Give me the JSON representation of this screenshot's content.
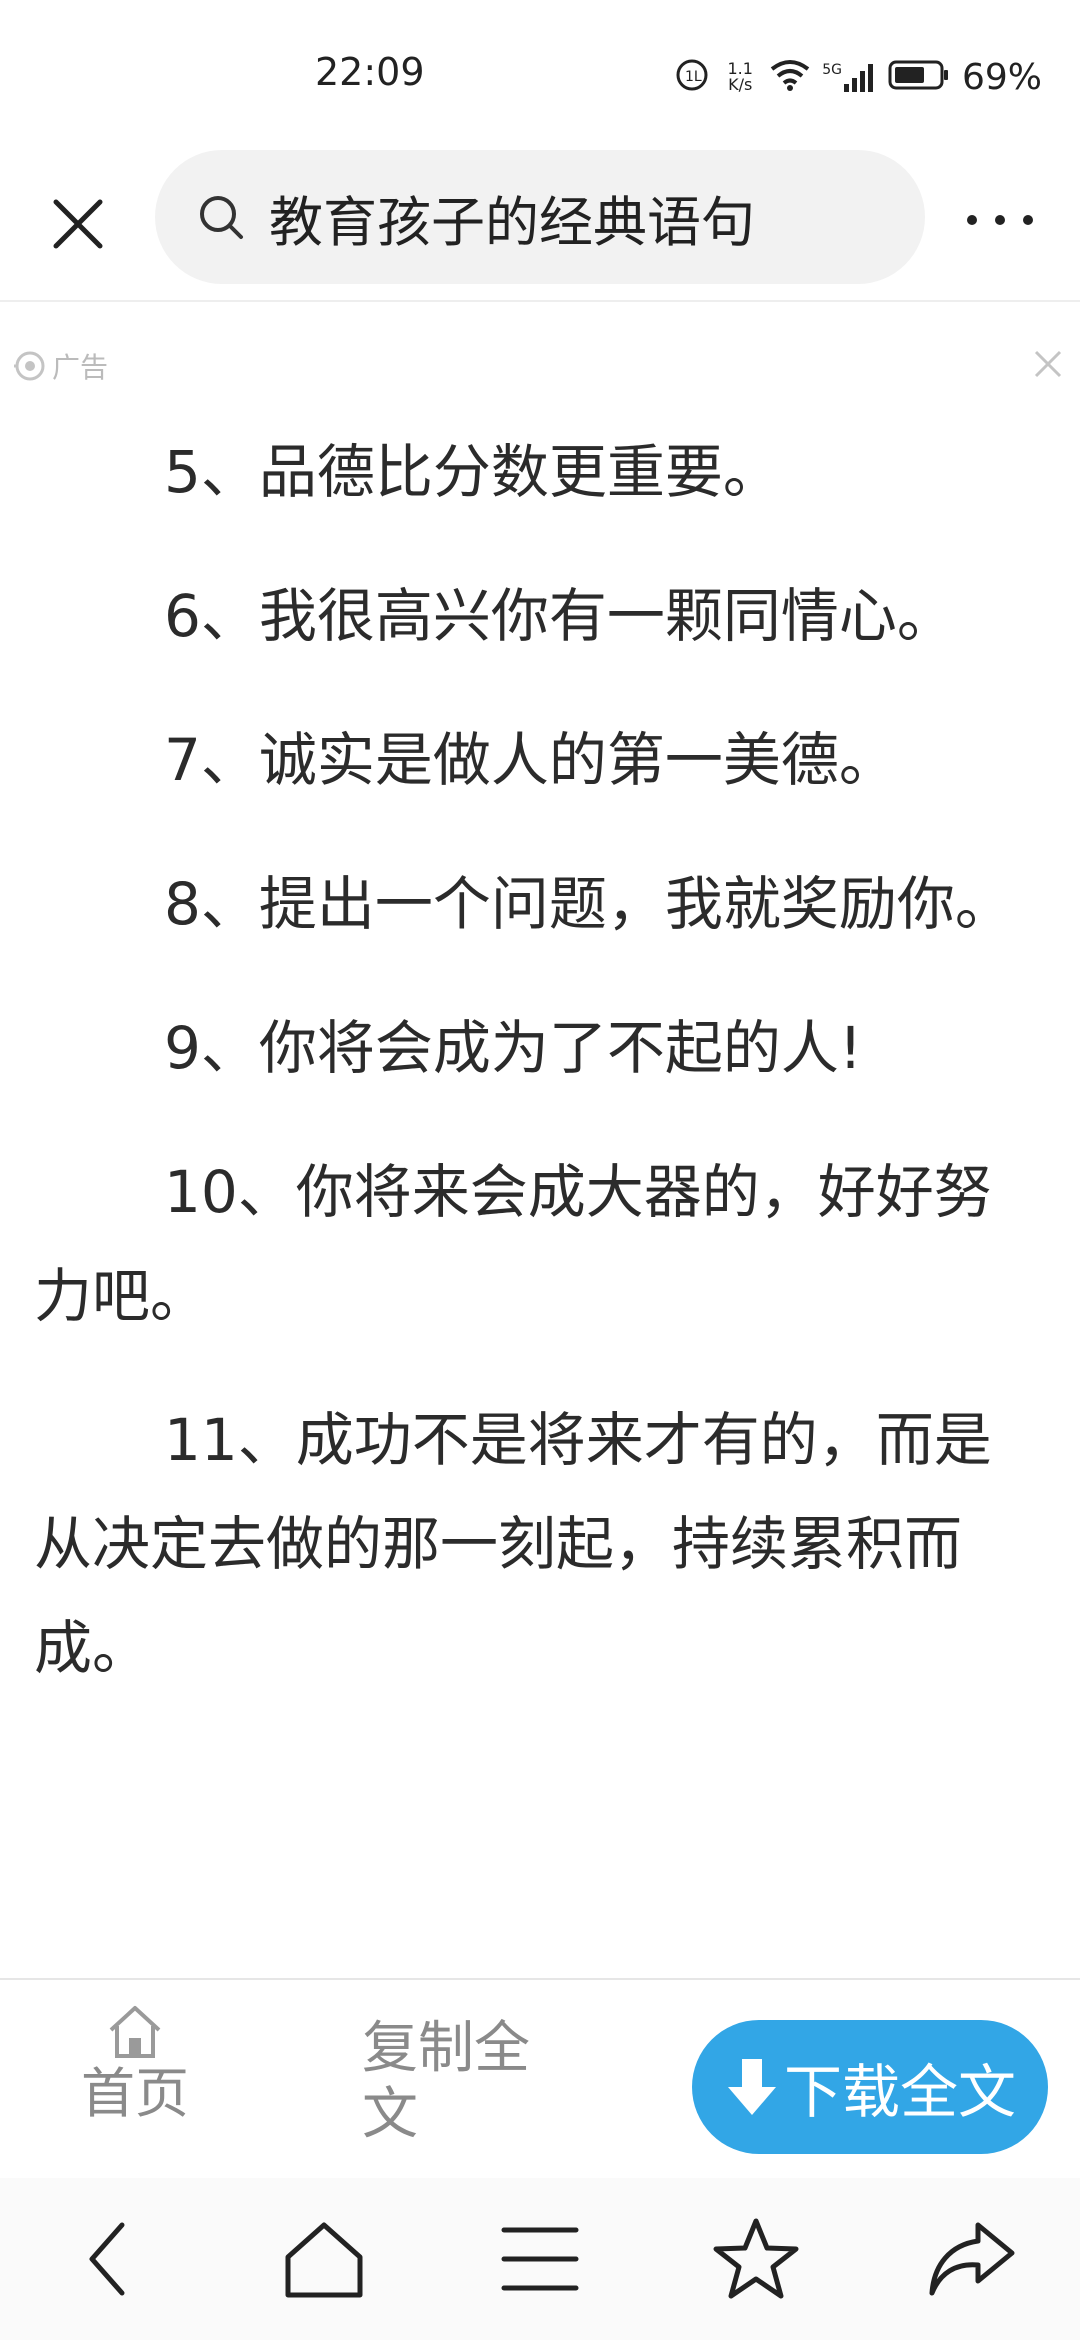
{
  "status_bar": {
    "time": "22:09",
    "net_speed_value": "1.1",
    "net_speed_unit": "K/s",
    "network_type": "5G",
    "battery_percent": "69%",
    "battery_level": 0.69
  },
  "header": {
    "search_query": "教育孩子的经典语句"
  },
  "ad": {
    "label": "广告"
  },
  "article": {
    "paragraphs": [
      "5、品德比分数更重要。",
      "6、我很高兴你有一颗同情心。",
      "7、诚实是做人的第一美德。",
      "8、提出一个问题，我就奖励你。",
      "9、你将会成为了不起的人!",
      "10、你将来会成大器的，好好努力吧。",
      "11、成功不是将来才有的，而是从决定去做的那一刻起，持续累积而成。"
    ]
  },
  "action_bar": {
    "home_label": "首页",
    "copy_label": "复制全文",
    "download_label": "下载全文",
    "download_color": "#32a6e6"
  },
  "icons": {
    "close": "close-icon",
    "search": "search-icon",
    "more": "more-dots-icon",
    "back": "back-arrow-icon",
    "home": "home-icon",
    "menu": "menu-icon",
    "favorite": "star-icon",
    "share": "share-icon"
  }
}
